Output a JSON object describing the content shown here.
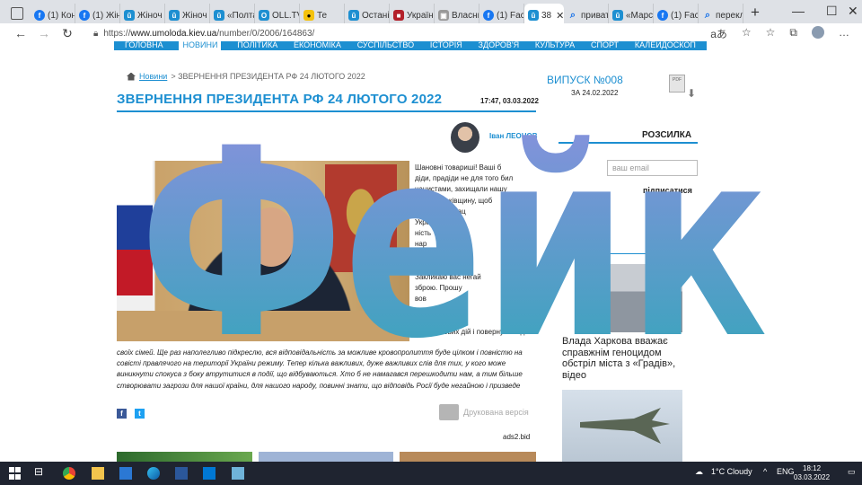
{
  "browser": {
    "tabs": [
      {
        "label": "(1) Кон",
        "icon": "facebook-icon"
      },
      {
        "label": "(1) Жін",
        "icon": "facebook-icon"
      },
      {
        "label": "Жіноч",
        "icon": "umoloda-icon"
      },
      {
        "label": "Жіноч",
        "icon": "umoloda-icon"
      },
      {
        "label": "«Полта",
        "icon": "umoloda-icon"
      },
      {
        "label": "OLL.TV",
        "icon": "oll-icon"
      },
      {
        "label": "Те",
        "icon": "yellow-icon"
      },
      {
        "label": "Остані",
        "icon": "umoloda-icon"
      },
      {
        "label": "Україн",
        "icon": "red-icon"
      },
      {
        "label": "Власни",
        "icon": "grey-icon"
      },
      {
        "label": "(1) Face",
        "icon": "facebook-icon"
      },
      {
        "label": "38",
        "icon": "umoloda-icon",
        "active": true
      },
      {
        "label": "привать",
        "icon": "search-icon"
      },
      {
        "label": "«Марс",
        "icon": "umoloda-icon"
      },
      {
        "label": "(1) Face",
        "icon": "facebook-icon"
      },
      {
        "label": "переклі",
        "icon": "search-icon"
      }
    ],
    "url_prefix": "https://",
    "url_domain": "www.umoloda.kiev.ua",
    "url_path": "/number/0/2006/164863/"
  },
  "site": {
    "nav": [
      "ГОЛОВНА",
      "НОВИНИ",
      "ПОЛІТИКА",
      "ЕКОНОМІКА",
      "СУСПІЛЬСТВО",
      "ІСТОРІЯ",
      "ЗДОРОВ'Я",
      "КУЛЬТУРА",
      "СПОРТ",
      "КАЛЕЙДОСКОП"
    ],
    "nav_active": 1,
    "accent": "#1d8fd1"
  },
  "article": {
    "crumb_link": "Новини",
    "crumb_rest": "> ЗВЕРНЕННЯ ПРЕЗИДЕНТА РФ 24 ЛЮТОГО 2022",
    "title": "ЗВЕРНЕННЯ ПРЕЗИДЕНТА РФ 24 ЛЮТОГО 2022",
    "datetime": "17:47, 03.03.2022",
    "author": "Іван ЛЕОНОВ",
    "lead_lines": [
      "Шановні товариші! Ваші б",
      "діди, прадіди не для того бил",
      "нацистами, захищали нашу",
      "нашу батьківщину, щоб",
      "нинішні неонац",
      "Україні. Ви",
      "ність Т",
      "нар",
      "",
      "",
      "Закликаю вас негай",
      "зброю. Прошу",
      "вов",
      "ають",
      "зону безпереш",
      "зону бойових дій і повернутися до"
    ],
    "body": "своїх сімей. Ще раз наполегливо підкреслю, вся відповідальність за можливе кровопролиття буде цілком і повністю на совісті правлячого на території України режиму. Тепер кілька важливих, дуже важливих слів для тих, у кого може виникнути спокуса з боку втрутитися в події, що відбуваються. Хто б не намагався перешкодити нам, а тим більше створювати загрози для нашої країни, для нашого народу, повинні знати, що відповідь Росії буде негайною і призведе",
    "share_fb": "f",
    "share_tw": "t",
    "print_label": "Друкована версія",
    "ads_label": "ads2.bid"
  },
  "sidebar": {
    "issue": "ВИПУСК №008",
    "issue_date": "ЗА 24.02.2022",
    "pdf_label": "PDF",
    "newsletter_title": "РОЗСИЛКА",
    "email_placeholder": "ваш email",
    "subscribe_label": "підписатися",
    "news_item": "Влада Харкова вважає справжнім геноцидом обстріл міста з «Градів», відео"
  },
  "overlay": {
    "text": "Фейк",
    "color_top": "#8f8fe0",
    "color_bottom": "#2fa7b8"
  },
  "taskbar": {
    "weather": "1°C  Cloudy",
    "lang": "ENG",
    "time": "18:12",
    "date": "03.03.2022"
  }
}
